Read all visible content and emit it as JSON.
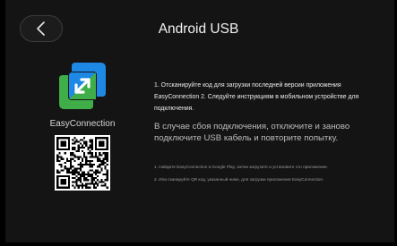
{
  "header": {
    "title": "Android USB",
    "back_icon": "chevron-left-icon"
  },
  "app": {
    "name": "EasyConnection",
    "logo_icon": "easyconnection-logo-icon",
    "logo_colors": {
      "blue": "#1e88e5",
      "green": "#3fae49"
    }
  },
  "instructions": {
    "step1": "1. Отсканируйте код для загрузки последней версии приложения EasyConnection 2. Следуйте инструкциям в мобильном устройстве для подключения.",
    "reconnect": "В случае сбоя подключения, отключите и заново подключите USB кабель и повторите попытку.",
    "note1": "1. Найдите EasyConnection в Google Play, затем загрузите и установите это приложение.",
    "note2": "2. Или сканируйте QR код, указанный ниже, для загрузки приложения EasyConnection."
  }
}
